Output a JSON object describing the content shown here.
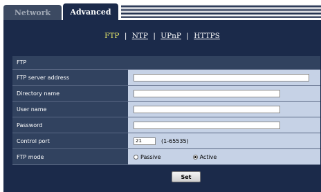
{
  "tabs": {
    "network": "Network",
    "advanced": "Advanced"
  },
  "subnav": {
    "ftp": "FTP",
    "ntp": "NTP",
    "upnp": "UPnP",
    "https": "HTTPS",
    "separator": "|"
  },
  "section": {
    "title": "FTP"
  },
  "fields": {
    "server_address": {
      "label": "FTP server address",
      "value": ""
    },
    "directory": {
      "label": "Directory name",
      "value": ""
    },
    "user": {
      "label": "User name",
      "value": ""
    },
    "password": {
      "label": "Password",
      "value": ""
    },
    "port": {
      "label": "Control port",
      "value": "21",
      "range": "(1-65535)"
    },
    "mode": {
      "label": "FTP mode",
      "options": [
        "Passive",
        "Active"
      ],
      "selected": "Active"
    }
  },
  "set_label": "Set",
  "colors": {
    "panel": "#1b2a4a",
    "label_bg": "#31425f",
    "value_bg": "#c6d2e6",
    "current_link": "#e6e76a"
  }
}
